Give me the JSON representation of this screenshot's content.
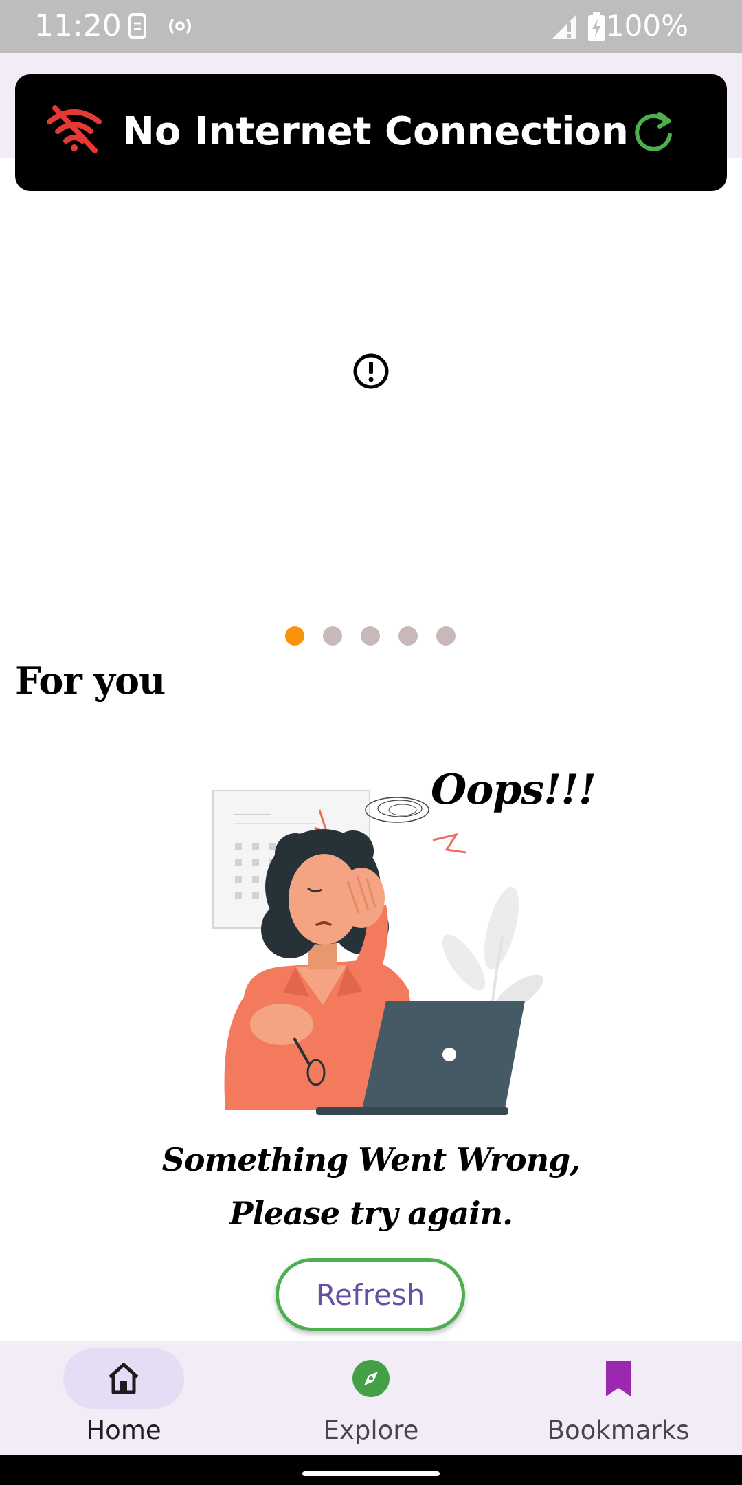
{
  "status_bar": {
    "time": "11:20",
    "battery": "100%",
    "icons": [
      "sim-icon",
      "hotspot-icon",
      "signal-icon",
      "battery-charging-icon"
    ]
  },
  "banner": {
    "message": "No Internet Connection",
    "wifi_icon_color": "#e53935",
    "refresh_icon_color": "#4caf50"
  },
  "carousel": {
    "page_count": 5,
    "active_index": 0,
    "active_color": "#f7940c",
    "inactive_color": "#c9b8b8"
  },
  "section": {
    "title": "For you"
  },
  "error": {
    "illustration_caption": "Oops!!!",
    "line1": "Something Went Wrong,",
    "line2": "Please try again.",
    "button_label": "Refresh"
  },
  "bottom_nav": {
    "items": [
      {
        "label": "Home",
        "icon": "home-icon",
        "selected": true
      },
      {
        "label": "Explore",
        "icon": "compass-icon",
        "selected": false
      },
      {
        "label": "Bookmarks",
        "icon": "bookmark-icon",
        "selected": false
      }
    ]
  }
}
